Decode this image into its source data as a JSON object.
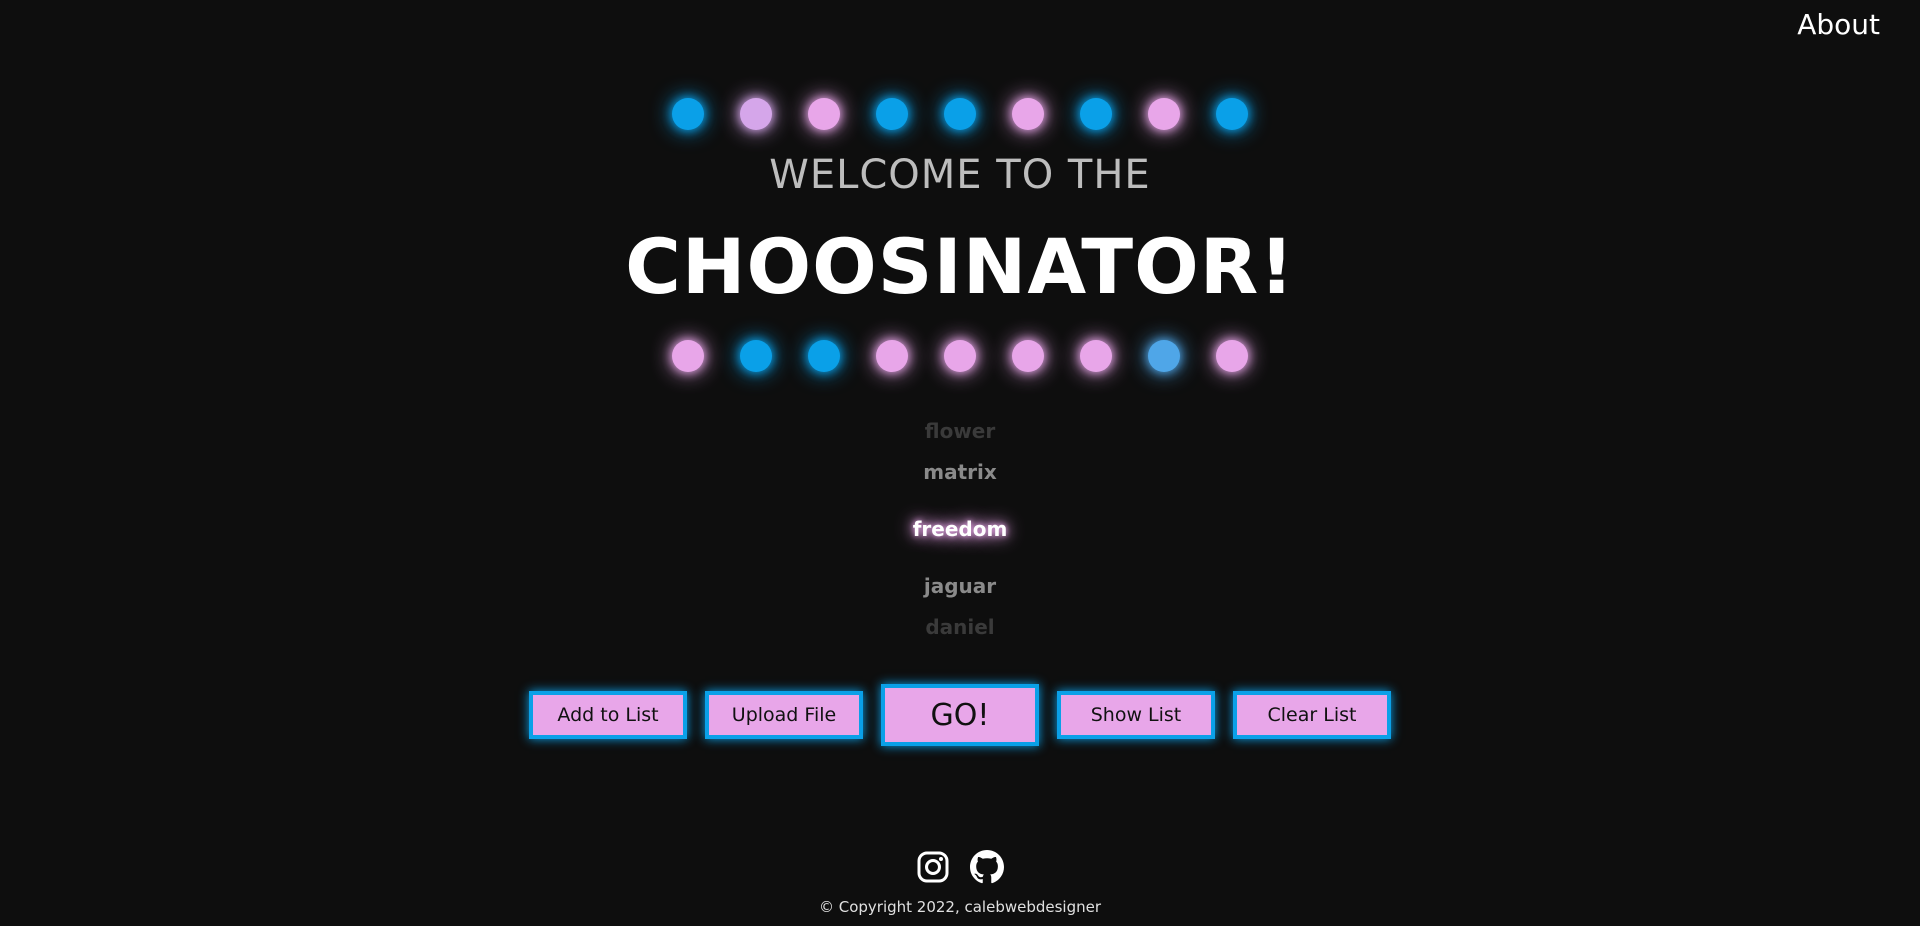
{
  "nav": {
    "about_label": "About"
  },
  "header": {
    "welcome": "WELCOME TO THE",
    "title": "CHOOSINATOR!"
  },
  "colors": {
    "blue": "#0aa0e8",
    "pink": "#e8a6e9",
    "lavender": "#d5a6ea",
    "lightblue": "#4fa6e8"
  },
  "lights": {
    "top": [
      "blue",
      "lavender",
      "pink",
      "blue",
      "blue",
      "pink",
      "blue",
      "pink",
      "blue"
    ],
    "bottom": [
      "pink",
      "blue",
      "blue",
      "pink",
      "pink",
      "pink",
      "pink",
      "lightblue",
      "pink"
    ]
  },
  "wheel": {
    "items": [
      "flower",
      "matrix",
      "freedom",
      "jaguar",
      "daniel"
    ]
  },
  "buttons": {
    "add_label": "Add to List",
    "upload_label": "Upload File",
    "go_label": "GO!",
    "show_label": "Show List",
    "clear_label": "Clear List"
  },
  "footer": {
    "icons": [
      "instagram-icon",
      "github-icon"
    ],
    "copyright": "© Copyright 2022, calebwebdesigner"
  }
}
